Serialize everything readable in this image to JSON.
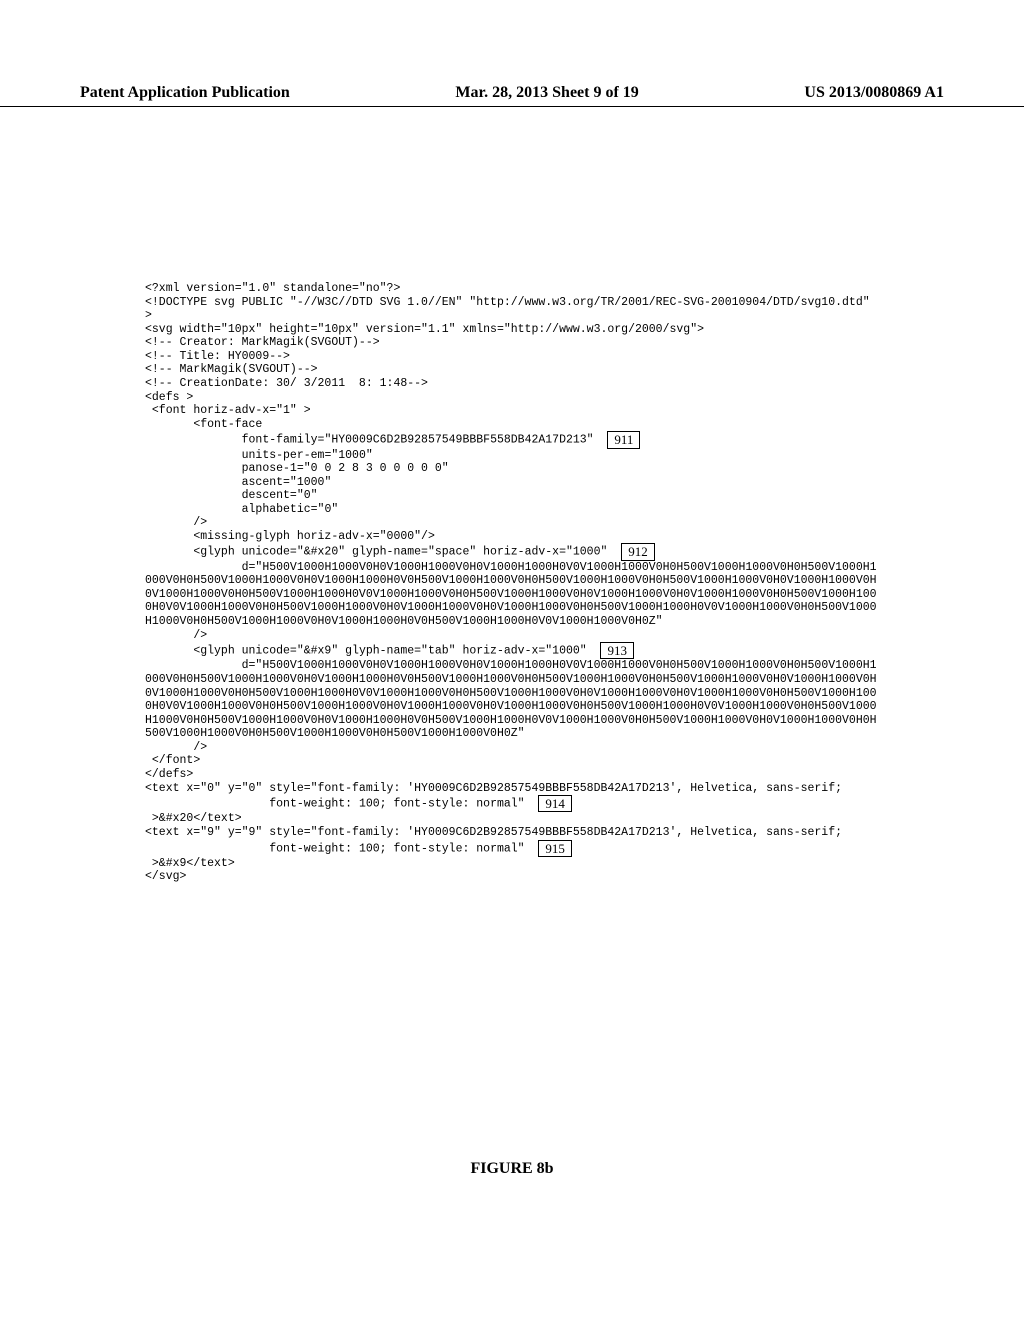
{
  "header": {
    "left": "Patent Application Publication",
    "center": "Mar. 28, 2013  Sheet 9 of 19",
    "right": "US 2013/0080869 A1"
  },
  "code": {
    "l1": "<?xml version=\"1.0\" standalone=\"no\"?>",
    "l2": "<!DOCTYPE svg PUBLIC \"-//W3C//DTD SVG 1.0//EN\" \"http://www.w3.org/TR/2001/REC-SVG-20010904/DTD/svg10.dtd\" >",
    "l3": "<svg width=\"10px\" height=\"10px\" version=\"1.1\" xmlns=\"http://www.w3.org/2000/svg\">",
    "l4": "<!-- Creator: MarkMagik(SVGOUT)-->",
    "l5": "<!-- Title: HY0009-->",
    "l6": "<!-- MarkMagik(SVGOUT)-->",
    "l7": "<!-- CreationDate: 30/ 3/2011  8: 1:48-->",
    "l8": "<defs >",
    "l9": " <font horiz-adv-x=\"1\" >",
    "l10": "       <font-face",
    "l11": "              font-family=\"HY0009C6D2B92857549BBBF558DB42A17D213\"  ",
    "l12": "              units-per-em=\"1000\"",
    "l13": "              panose-1=\"0 0 2 8 3 0 0 0 0 0\"",
    "l14": "              ascent=\"1000\"",
    "l15": "              descent=\"0\"",
    "l16": "              alphabetic=\"0\"",
    "l17": "       />",
    "l18": "       <missing-glyph horiz-adv-x=\"0000\"/>",
    "l19": "       <glyph unicode=\"&#x20\" glyph-name=\"space\" horiz-adv-x=\"1000\"  ",
    "l20": "              d=\"H500V1000H1000V0H0V1000H1000V0H0V1000H1000H0V0V1000H1000V0H0H500V1000H1000V0H0H500V1000H1000V0H0H500V1000H1000V0H0V1000H1000H0V0H500V1000H1000V0H0H500V1000H1000V0H0H500V1000H1000V0H0V1000H1000V0H0V1000H1000V0H0H500V1000H1000H0V0V1000H1000V0H0H500V1000H1000V0H0V1000H1000V0H0V1000H1000V0H0H500V1000H1000H0V0V1000H1000V0H0H500V1000H1000V0H0V1000H1000V0H0V1000H1000V0H0H500V1000H1000H0V0V1000H1000V0H0H500V1000H1000V0H0H500V1000H1000V0H0V1000H1000H0V0H500V1000H1000H0V0V1000H1000V0H0Z\"",
    "l21": "       />",
    "l22": "       <glyph unicode=\"&#x9\" glyph-name=\"tab\" horiz-adv-x=\"1000\"  ",
    "l23": "              d=\"H500V1000H1000V0H0V1000H1000V0H0V1000H1000H0V0V1000H1000V0H0H500V1000H1000V0H0H500V1000H1000V0H0H500V1000H1000V0H0V1000H1000H0V0H500V1000H1000V0H0H500V1000H1000V0H0H500V1000H1000V0H0V1000H1000V0H0V1000H1000V0H0H500V1000H1000H0V0V1000H1000V0H0H500V1000H1000V0H0V1000H1000V0H0V1000H1000V0H0H500V1000H1000H0V0V1000H1000V0H0H500V1000H1000V0H0V1000H1000V0H0V1000H1000V0H0H500V1000H1000H0V0V1000H1000V0H0H500V1000H1000V0H0H500V1000H1000V0H0V1000H1000H0V0H500V1000H1000H0V0V1000H1000V0H0H500V1000H1000V0H0V1000H1000V0H0H500V1000H1000V0H0H500V1000H1000V0H0H500V1000H1000V0H0Z\"",
    "l24": "       />",
    "l25": " </font>",
    "l26": "</defs>",
    "l27": "<text x=\"0\" y=\"0\" style=\"font-family: 'HY0009C6D2B92857549BBBF558DB42A17D213', Helvetica, sans-serif;",
    "l28": "                  font-weight: 100; font-style: normal\"  ",
    "l29": " >&#x20</text>",
    "l30": "<text x=\"9\" y=\"9\" style=\"font-family: 'HY0009C6D2B92857549BBBF558DB42A17D213', Helvetica, sans-serif;",
    "l31": "                  font-weight: 100; font-style: normal\"  ",
    "l32": " >&#x9</text>",
    "l33": "</svg>"
  },
  "callouts": {
    "c911": "911",
    "c912": "912",
    "c913": "913",
    "c914": "914",
    "c915": "915"
  },
  "figure_caption": "FIGURE 8b"
}
